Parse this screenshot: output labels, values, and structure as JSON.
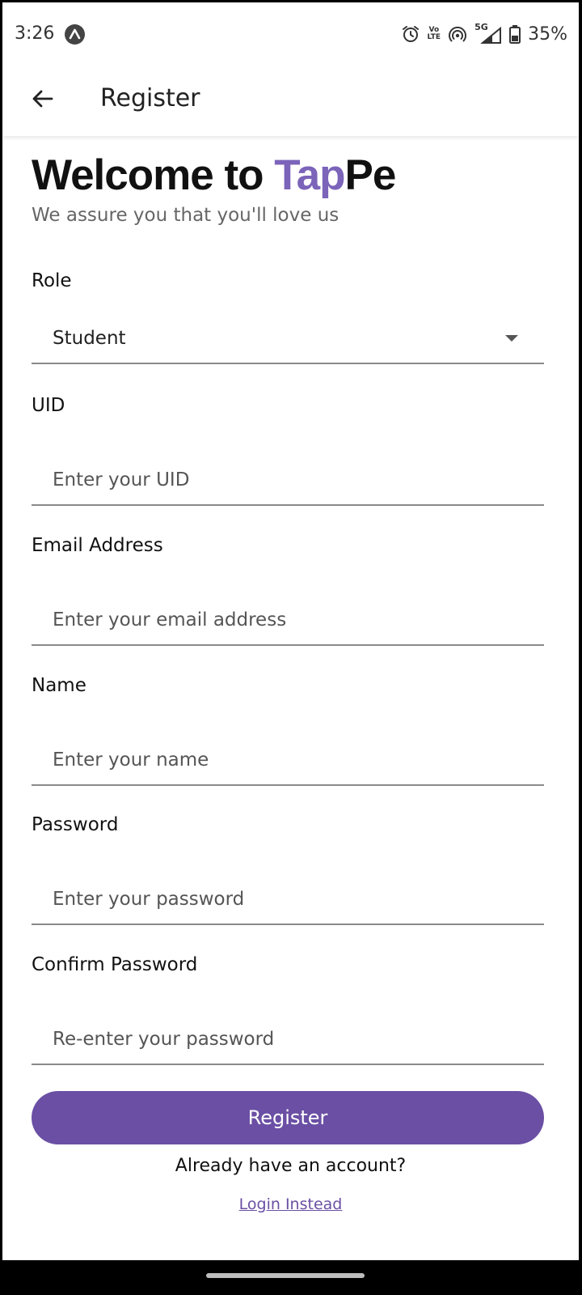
{
  "status_bar": {
    "time": "3:26",
    "battery": "35%",
    "icons": [
      "app-notification-icon",
      "alarm-icon",
      "volte-icon",
      "hotspot-icon",
      "signal-5g-icon",
      "battery-icon"
    ],
    "volte_label_top": "Vo",
    "volte_label_bottom": "LTE",
    "network_label": "5G"
  },
  "app_bar": {
    "title": "Register",
    "back_icon": "arrow-left-icon"
  },
  "welcome": {
    "prefix": "Welcome to ",
    "brand_highlight": "Tap",
    "brand_rest": "Pe",
    "subtitle": "We assure you that you'll love us"
  },
  "form": {
    "role": {
      "label": "Role",
      "value": "Student"
    },
    "uid": {
      "label": "UID",
      "value": "",
      "placeholder": "Enter your UID"
    },
    "email": {
      "label": "Email Address",
      "value": "",
      "placeholder": "Enter your email address"
    },
    "name": {
      "label": "Name",
      "value": "",
      "placeholder": "Enter your name"
    },
    "password": {
      "label": "Password",
      "value": "",
      "placeholder": "Enter your password"
    },
    "confirm_password": {
      "label": "Confirm Password",
      "value": "",
      "placeholder": "Re-enter your password"
    }
  },
  "actions": {
    "register_label": "Register",
    "already_text": "Already have an account?",
    "login_label": "Login Instead"
  },
  "colors": {
    "brand_accent": "#7b64b9",
    "button": "#6a4fa4",
    "link": "#6a4fa4"
  }
}
